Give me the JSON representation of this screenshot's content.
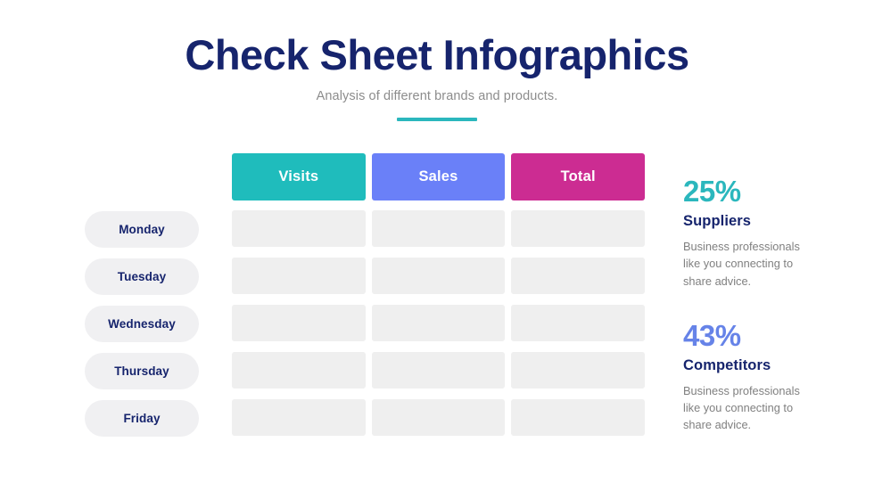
{
  "header": {
    "title": "Check Sheet Infographics",
    "subtitle": "Analysis of different brands and products.",
    "divider_color": "#2bb7bd"
  },
  "table": {
    "columns": [
      {
        "label": "Visits",
        "color": "#1fbcbc"
      },
      {
        "label": "Sales",
        "color": "#6a80f8"
      },
      {
        "label": "Total",
        "color": "#cc2c92"
      }
    ],
    "rows": [
      {
        "label": "Monday",
        "cells": [
          "",
          "",
          ""
        ]
      },
      {
        "label": "Tuesday",
        "cells": [
          "",
          "",
          ""
        ]
      },
      {
        "label": "Wednesday",
        "cells": [
          "",
          "",
          ""
        ]
      },
      {
        "label": "Thursday",
        "cells": [
          "",
          "",
          ""
        ]
      },
      {
        "label": "Friday",
        "cells": [
          "",
          "",
          ""
        ]
      }
    ],
    "cell_color": "#efefef",
    "row_label_color": "#f0f0f2"
  },
  "stats": [
    {
      "value": "25%",
      "value_color": "#2bb7bd",
      "label": "Suppliers",
      "description": "Business professionals like you connecting to share advice."
    },
    {
      "value": "43%",
      "value_color": "#6683e8",
      "label": "Competitors",
      "description": "Business professionals like you connecting to share advice."
    }
  ],
  "theme": {
    "navy": "#16246d",
    "gray_text": "#808080",
    "subtitle_gray": "#8c8c8c",
    "background": "#ffffff"
  }
}
